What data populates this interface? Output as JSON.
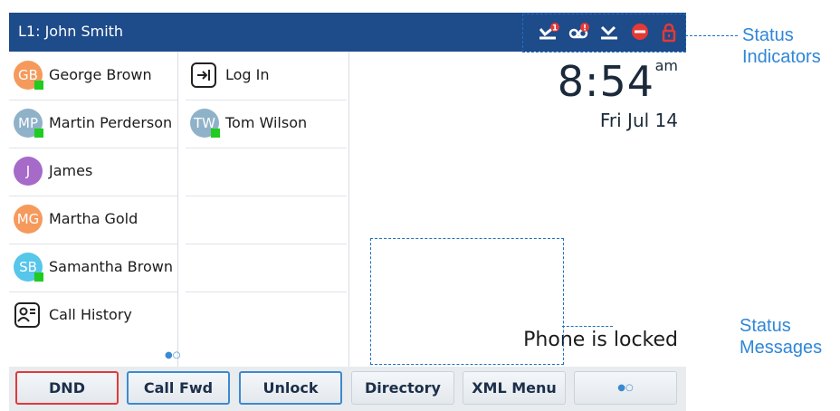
{
  "header": {
    "line_label": "L1: John Smith"
  },
  "status_icons": [
    {
      "name": "missed-call-icon",
      "badge": "1",
      "color": "#ffffff"
    },
    {
      "name": "voicemail-icon",
      "badge": "!",
      "color": "#ffffff"
    },
    {
      "name": "forward-icon",
      "color": "#ffffff"
    },
    {
      "name": "dnd-icon",
      "color": "#e53935"
    },
    {
      "name": "lock-icon",
      "color": "#e53935"
    }
  ],
  "contacts": [
    {
      "initials": "GB",
      "name": "George Brown",
      "color": "#f59a5c",
      "presence": true
    },
    {
      "initials": "MP",
      "name": "Martin Perderson",
      "color": "#8fb2c9",
      "presence": true
    },
    {
      "initials": "J",
      "name": "James",
      "color": "#a66bc9",
      "presence": false
    },
    {
      "initials": "MG",
      "name": "Martha Gold",
      "color": "#f59a5c",
      "presence": false
    },
    {
      "initials": "SB",
      "name": "Samantha Brown",
      "color": "#56c6ea",
      "presence": true
    }
  ],
  "call_history": {
    "label": "Call History"
  },
  "col2": {
    "login": {
      "label": "Log In"
    },
    "tom": {
      "initials": "TW",
      "name": "Tom Wilson",
      "color": "#8fb2c9",
      "presence": true
    }
  },
  "clock": {
    "time": "8:54",
    "ampm": "am",
    "date": "Fri Jul 14"
  },
  "status_message": "Phone is locked",
  "page_dots": "●○",
  "softkeys": [
    {
      "label": "DND",
      "style": "red"
    },
    {
      "label": "Call Fwd",
      "style": "blue"
    },
    {
      "label": "Unlock",
      "style": "blue"
    },
    {
      "label": "Directory",
      "style": "normal"
    },
    {
      "label": "XML Menu",
      "style": "normal"
    },
    {
      "label": "●○",
      "style": "normal"
    }
  ],
  "callouts": {
    "status_indicators": [
      "Status",
      "Indicators"
    ],
    "status_messages": [
      "Status",
      "Messages"
    ]
  }
}
